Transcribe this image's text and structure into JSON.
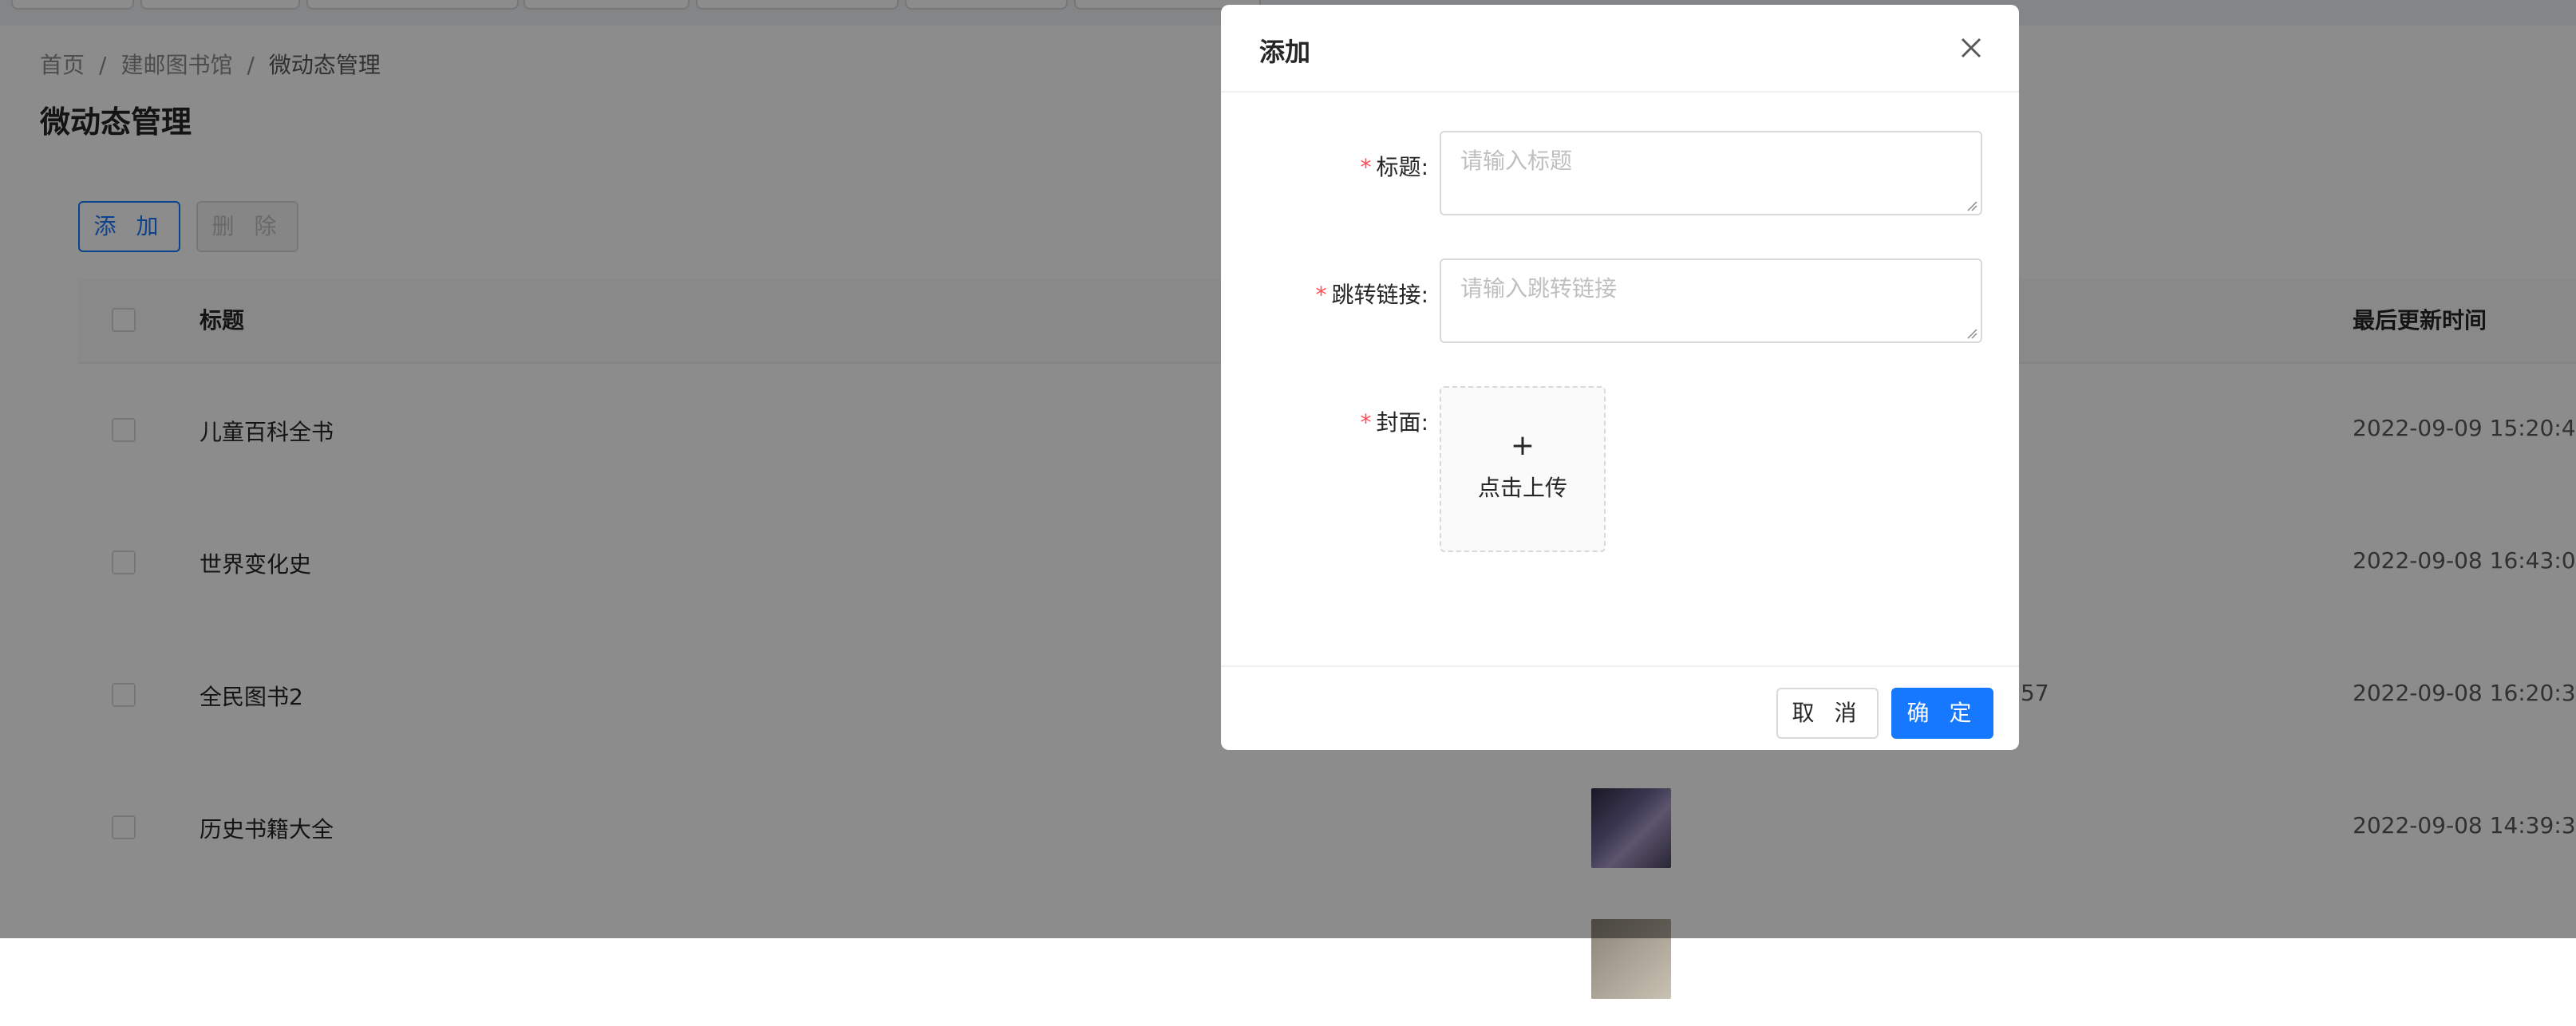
{
  "breadcrumb": {
    "items": [
      "首页",
      "建邮图书馆",
      "微动态管理"
    ],
    "separator": "/"
  },
  "page": {
    "title": "微动态管理"
  },
  "toolbar": {
    "add_label": "添 加",
    "delete_label": "删 除"
  },
  "table": {
    "columns": {
      "title": "标题",
      "updated": "最后更新时间"
    },
    "rows": [
      {
        "title": "儿童百科全书",
        "extra": "",
        "updated": "2022-09-09 15:20:4"
      },
      {
        "title": "世界变化史",
        "extra": "",
        "updated": "2022-09-08 16:43:0"
      },
      {
        "title": "全民图书2",
        "extra": "57",
        "updated": "2022-09-08 16:20:3"
      },
      {
        "title": "历史书籍大全",
        "extra": "",
        "updated": "2022-09-08 14:39:3"
      }
    ]
  },
  "modal": {
    "title": "添加",
    "fields": {
      "title_label": "标题",
      "title_placeholder": "请输入标题",
      "link_label": "跳转链接",
      "link_placeholder": "请输入跳转链接",
      "cover_label": "封面",
      "upload_plus": "+",
      "upload_text": "点击上传"
    },
    "required_mark": "*",
    "label_suffix": ":",
    "cancel_label": "取 消",
    "ok_label": "确 定"
  },
  "colors": {
    "primary": "#1677ff",
    "required": "#ff4d4f",
    "mask": "rgba(0,0,0,0.45)"
  },
  "icons": {
    "close": "close-icon",
    "resize": "resize-grip-icon"
  }
}
